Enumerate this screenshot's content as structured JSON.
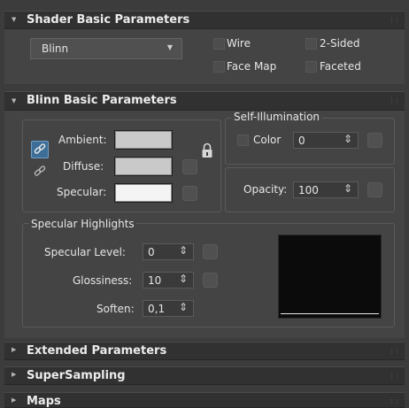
{
  "shader_rollout": {
    "title": "Shader Basic Parameters",
    "shader_dropdown": {
      "value": "Blinn"
    },
    "options": {
      "wire": "Wire",
      "two_sided": "2-Sided",
      "face_map": "Face Map",
      "faceted": "Faceted"
    }
  },
  "blinn_rollout": {
    "title": "Blinn Basic Parameters",
    "ambient_label": "Ambient:",
    "diffuse_label": "Diffuse:",
    "specular_label": "Specular:",
    "self_illum": {
      "title": "Self-Illumination",
      "color_label": "Color",
      "value": "0"
    },
    "opacity": {
      "label": "Opacity:",
      "value": "100"
    },
    "specular_highlights": {
      "title": "Specular Highlights",
      "specular_level": {
        "label": "Specular Level:",
        "value": "0"
      },
      "glossiness": {
        "label": "Glossiness:",
        "value": "10"
      },
      "soften": {
        "label": "Soften:",
        "value": "0,1"
      }
    }
  },
  "collapsed_rollouts": {
    "extended": "Extended Parameters",
    "supersampling": "SuperSampling",
    "maps": "Maps"
  },
  "colors": {
    "swatch_gray": "#c9c9c9",
    "swatch_white": "#f4f4f4",
    "lock_active": "#3d6e97",
    "preview_bg": "#0b0b0b"
  },
  "icons": {
    "expand": "triangle-down",
    "collapse": "triangle-right",
    "lock": "padlock",
    "link": "chain-link"
  }
}
